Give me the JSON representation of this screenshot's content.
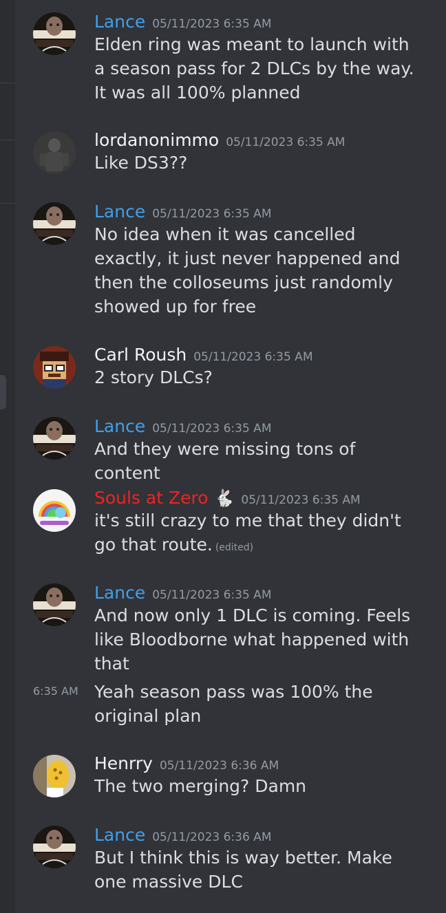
{
  "colors": {
    "background": "#313338",
    "lance": "#3fa0ea",
    "souls": "#ed2424",
    "default_name": "#f2f3f5",
    "timestamp": "#949ba4",
    "text": "#dbdee1"
  },
  "messages": [
    {
      "author": "Lance",
      "timestamp": "05/11/2023 6:35 AM",
      "text": "Elden ring was meant to launch with a season pass for 2 DLCs by the way. It was all 100% planned"
    },
    {
      "author": "lordanonimmo",
      "timestamp": "05/11/2023 6:35 AM",
      "text": "Like DS3??"
    },
    {
      "author": "Lance",
      "timestamp": "05/11/2023 6:35 AM",
      "text": "No idea when it was cancelled exactly, it just never happened and then the colloseums just randomly showed up for free"
    },
    {
      "author": "Carl Roush",
      "timestamp": "05/11/2023 6:35 AM",
      "text": "2 story DLCs?"
    },
    {
      "author": "Lance",
      "timestamp": "05/11/2023 6:35 AM",
      "text": "And they were missing tons of content"
    },
    {
      "author": "Souls at Zero",
      "badge_icon": "rabbit-icon",
      "timestamp": "05/11/2023 6:35 AM",
      "text": "it's still crazy to me that they didn't go that route.",
      "edited_label": "(edited)"
    },
    {
      "author": "Lance",
      "timestamp": "05/11/2023 6:35 AM",
      "text": "And now only 1 DLC is coming. Feels like Bloodborne what happened with that",
      "followup": {
        "timestamp": "6:35 AM",
        "text": "Yeah season pass was 100% the original plan"
      }
    },
    {
      "author": "Henrry",
      "timestamp": "05/11/2023 6:36 AM",
      "text": "The two merging? Damn"
    },
    {
      "author": "Lance",
      "timestamp": "05/11/2023 6:36 AM",
      "text": "But I think this is way better. Make one massive DLC"
    }
  ]
}
